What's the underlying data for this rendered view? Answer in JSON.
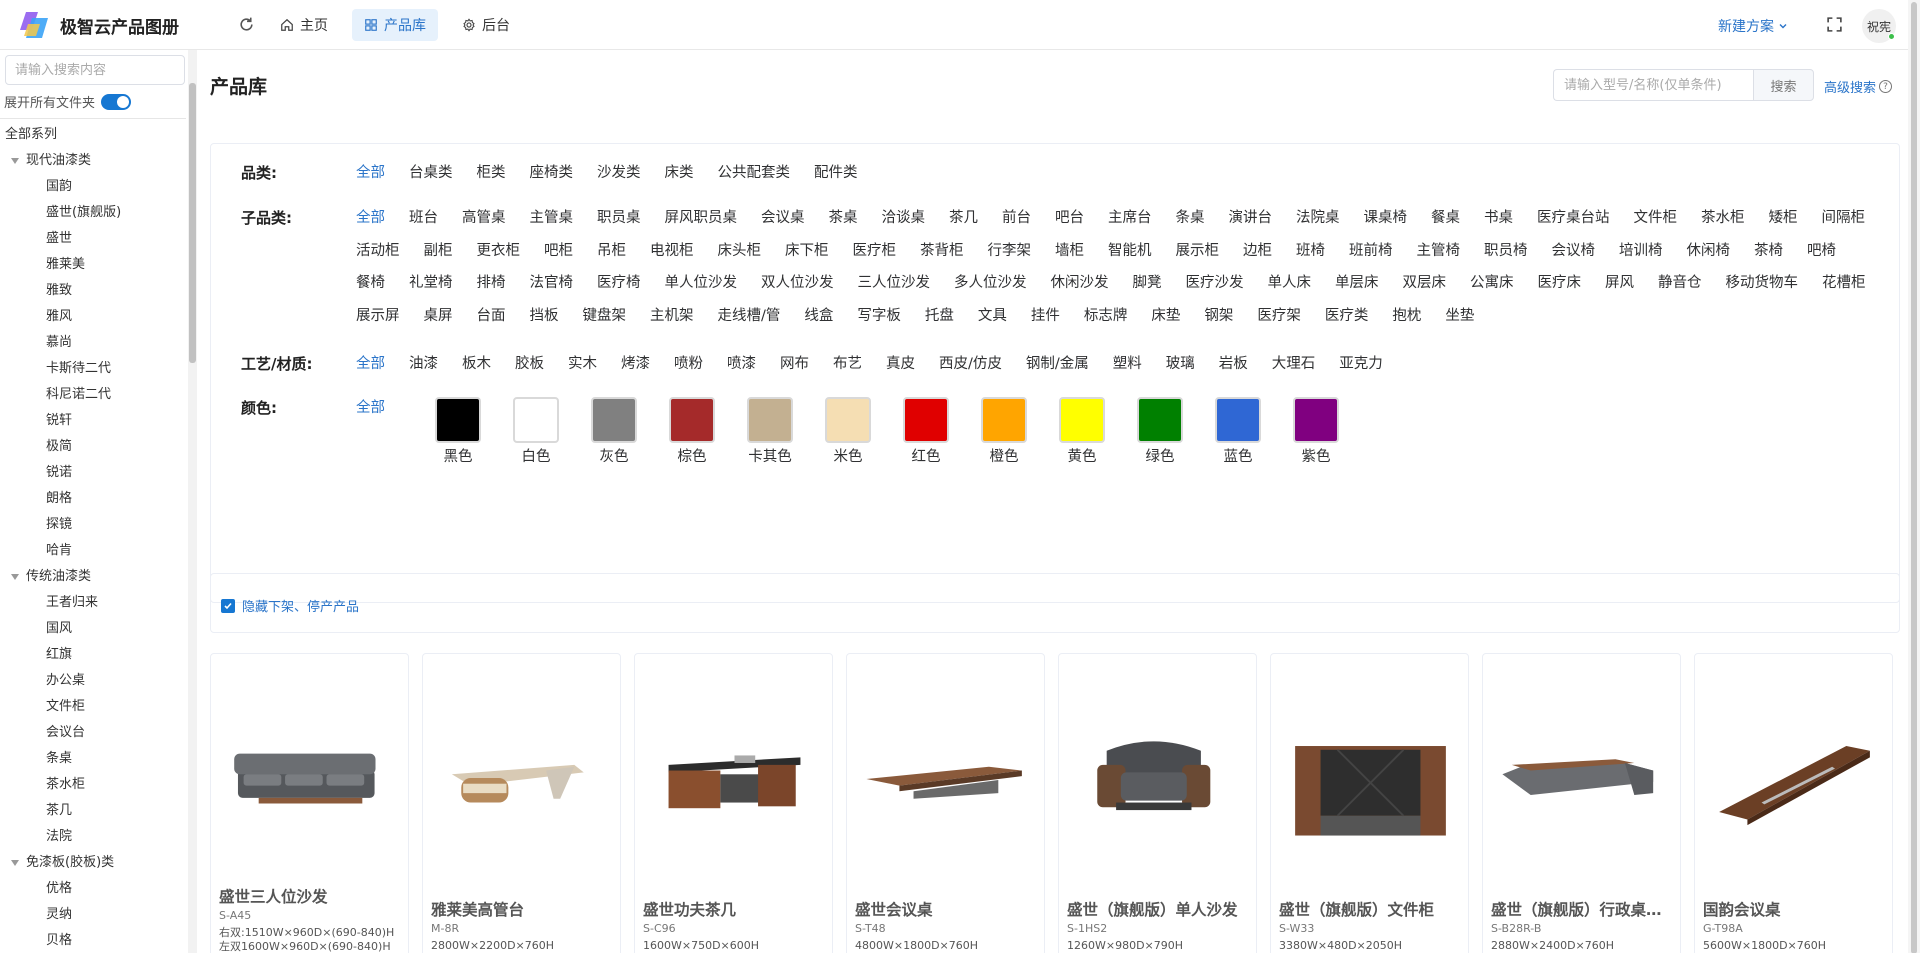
{
  "app": {
    "title": "极智云产品图册"
  },
  "nav": {
    "home": "主页",
    "library": "产品库",
    "backend": "后台",
    "new_scheme": "新建方案",
    "user": "祝宪"
  },
  "sidebar": {
    "search_placeholder": "请输入搜索内容",
    "expand_all": "展开所有文件夹",
    "root": "全部系列",
    "groups": [
      {
        "name": "现代油漆类",
        "items": [
          "国韵",
          "盛世(旗舰版)",
          "盛世",
          "雅莱美",
          "雅致",
          "雅风",
          "慕尚",
          "卡斯待二代",
          "科尼诺二代",
          "锐轩",
          "极简",
          "锐诺",
          "朗格",
          "探镜",
          "哈肯"
        ]
      },
      {
        "name": "传统油漆类",
        "items": [
          "王者归来",
          "国风",
          "红旗",
          "办公桌",
          "文件柜",
          "会议台",
          "条桌",
          "茶水柜",
          "茶几",
          "法院"
        ]
      },
      {
        "name": "免漆板(胶板)类",
        "items": [
          "优格",
          "灵纳",
          "贝格"
        ]
      }
    ]
  },
  "main": {
    "title": "产品库",
    "search_placeholder": "请输入型号/名称(仅单条件)",
    "search_button": "搜索",
    "advanced_search": "高级搜索",
    "filters": {
      "category": {
        "label": "品类:",
        "options": [
          "全部",
          "台桌类",
          "柜类",
          "座椅类",
          "沙发类",
          "床类",
          "公共配套类",
          "配件类"
        ]
      },
      "subcategory": {
        "label": "子品类:",
        "options": [
          "全部",
          "班台",
          "高管桌",
          "主管桌",
          "职员桌",
          "屏风职员桌",
          "会议桌",
          "茶桌",
          "洽谈桌",
          "茶几",
          "前台",
          "吧台",
          "主席台",
          "条桌",
          "演讲台",
          "法院桌",
          "课桌椅",
          "餐桌",
          "书桌",
          "医疗桌台站",
          "文件柜",
          "茶水柜",
          "矮柜",
          "间隔柜",
          "活动柜",
          "副柜",
          "更衣柜",
          "吧柜",
          "吊柜",
          "电视柜",
          "床头柜",
          "床下柜",
          "医疗柜",
          "茶背柜",
          "行李架",
          "墙柜",
          "智能机",
          "展示柜",
          "边柜",
          "班椅",
          "班前椅",
          "主管椅",
          "职员椅",
          "会议椅",
          "培训椅",
          "休闲椅",
          "茶椅",
          "吧椅",
          "餐椅",
          "礼堂椅",
          "排椅",
          "法官椅",
          "医疗椅",
          "单人位沙发",
          "双人位沙发",
          "三人位沙发",
          "多人位沙发",
          "休闲沙发",
          "脚凳",
          "医疗沙发",
          "单人床",
          "单层床",
          "双层床",
          "公寓床",
          "医疗床",
          "屏风",
          "静音仓",
          "移动货物车",
          "花槽柜",
          "展示屏",
          "桌屏",
          "台面",
          "挡板",
          "键盘架",
          "主机架",
          "走线槽/管",
          "线盒",
          "写字板",
          "托盘",
          "文具",
          "挂件",
          "标志牌",
          "床垫",
          "钢架",
          "医疗架",
          "医疗类",
          "抱枕",
          "坐垫"
        ]
      },
      "material": {
        "label": "工艺/材质:",
        "options": [
          "全部",
          "油漆",
          "板木",
          "胶板",
          "实木",
          "烤漆",
          "喷粉",
          "喷漆",
          "网布",
          "布艺",
          "真皮",
          "西皮/仿皮",
          "钢制/金属",
          "塑料",
          "玻璃",
          "岩板",
          "大理石",
          "亚克力"
        ]
      },
      "color": {
        "label": "颜色:",
        "all": "全部",
        "swatches": [
          {
            "name": "黑色",
            "hex": "#000000"
          },
          {
            "name": "白色",
            "hex": "#ffffff"
          },
          {
            "name": "灰色",
            "hex": "#808080"
          },
          {
            "name": "棕色",
            "hex": "#a52a2a"
          },
          {
            "name": "卡其色",
            "hex": "#c3b091"
          },
          {
            "name": "米色",
            "hex": "#f5deb3"
          },
          {
            "name": "红色",
            "hex": "#e00000"
          },
          {
            "name": "橙色",
            "hex": "#ffa500"
          },
          {
            "name": "黄色",
            "hex": "#ffff00"
          },
          {
            "name": "绿色",
            "hex": "#008000"
          },
          {
            "name": "蓝色",
            "hex": "#2f67d4"
          },
          {
            "name": "紫色",
            "hex": "#800080"
          }
        ]
      }
    },
    "hide_offline": "隐藏下架、停产产品",
    "products": [
      {
        "name": "盛世三人位沙发",
        "code": "S-A45",
        "specs": [
          "右双:1510W×960D×(690-840)H",
          "左双1600W×960D×(690-840)H"
        ],
        "image": "sofa-three-seat"
      },
      {
        "name": "雅莱美高管台",
        "code": "M-8R",
        "specs": [
          "2800W×2200D×760H"
        ],
        "image": "executive-desk"
      },
      {
        "name": "盛世功夫茶几",
        "code": "S-C96",
        "specs": [
          "1600W×750D×600H"
        ],
        "image": "tea-table"
      },
      {
        "name": "盛世会议桌",
        "code": "S-T48",
        "specs": [
          "4800W×1800D×760H"
        ],
        "image": "conference-table"
      },
      {
        "name": "盛世（旗舰版）单人沙发",
        "code": "S-1HS2",
        "specs": [
          "1260W×980D×790H"
        ],
        "image": "armchair"
      },
      {
        "name": "盛世（旗舰版）文件柜",
        "code": "S-W33",
        "specs": [
          "3380W×480D×2050H"
        ],
        "image": "file-cabinet"
      },
      {
        "name": "盛世（旗舰版）行政桌…",
        "code": "S-B28R-B",
        "specs": [
          "2880W×2400D×760H"
        ],
        "image": "admin-desk"
      },
      {
        "name": "国韵会议桌",
        "code": "G-T98A",
        "specs": [
          "5600W×1800D×760H"
        ],
        "image": "long-conference-table"
      }
    ]
  }
}
